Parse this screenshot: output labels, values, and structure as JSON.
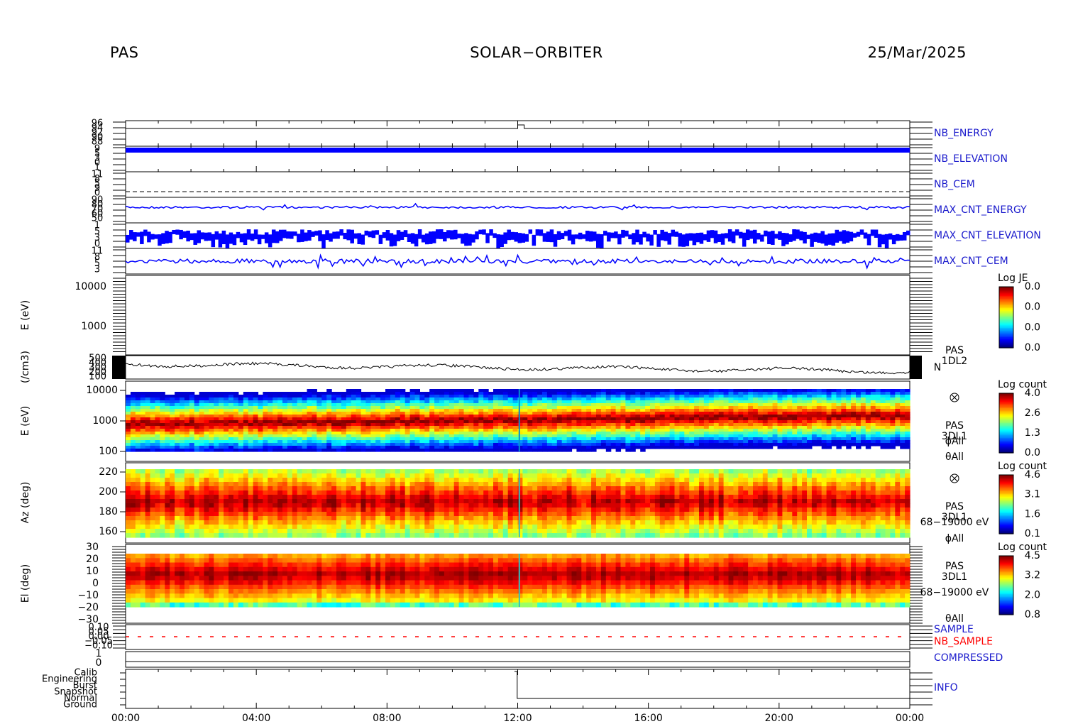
{
  "header": {
    "instrument": "PAS",
    "mission": "SOLAR−ORBITER",
    "date": "25/Mar/2025"
  },
  "colors": {
    "trace_blue": "#0000ff",
    "nb_sample_red": "#ff0000",
    "label_blue": "#1a1acc"
  },
  "chart_data": {
    "type": "heatmap",
    "time_axis": {
      "ticks": [
        "00:00",
        "04:00",
        "08:00",
        "12:00",
        "16:00",
        "20:00",
        "00:00"
      ],
      "range_hours": [
        0,
        24
      ]
    },
    "housekeeping_panels": [
      {
        "label": "NB_ENERGY",
        "y_ticks": [
          "96",
          "94",
          "92",
          "90",
          "88"
        ]
      },
      {
        "label": "NB_ELEVATION",
        "y_ticks": [
          "9",
          "5",
          "3",
          "0",
          "1"
        ]
      },
      {
        "label": "NB_CEM",
        "y_ticks": [
          "11",
          "8",
          "5",
          "9",
          "0"
        ]
      },
      {
        "label": "MAX_CNT_ENERGY",
        "y_ticks": [
          "90",
          "80",
          "70",
          "60",
          "50"
        ]
      },
      {
        "label": "MAX_CNT_ELEVATION",
        "y_ticks": [
          "1",
          "5",
          "3",
          "0"
        ]
      },
      {
        "label": "MAX_CNT_CEM",
        "y_ticks": [
          "11",
          "8",
          "5",
          "3"
        ]
      }
    ],
    "je_panel": {
      "ylabel": "E (eV)",
      "y_ticks": [
        "10000",
        "1000"
      ],
      "colorbar": {
        "title": "Log JE",
        "ticks": [
          "0.0",
          "0.0",
          "0.0",
          "0.0"
        ]
      }
    },
    "density_panel": {
      "ylabel": "(/cm3)",
      "y_ticks": [
        "500",
        "400",
        "300",
        "200",
        "100"
      ],
      "side_labels": [
        "PAS",
        "1DL2",
        "N"
      ],
      "median_density": 220
    },
    "energy_spectrogram": {
      "ylabel": "E (eV)",
      "y_ticks": [
        "10000",
        "1000",
        "100"
      ],
      "y_range_log": [
        2,
        4
      ],
      "side_labels": [
        "PAS",
        "3DL1",
        "ϕAll",
        "θAll"
      ],
      "colorbar": {
        "title": "Log count",
        "ticks": [
          "4.0",
          "2.6",
          "1.3",
          "0.0"
        ]
      }
    },
    "azimuth_spectrogram": {
      "ylabel": "Az (deg)",
      "y_ticks": [
        "220",
        "200",
        "180",
        "160"
      ],
      "y_range": [
        153,
        227
      ],
      "side_labels": [
        "PAS",
        "3DL1",
        "68−19000 eV",
        "ϕAll"
      ],
      "colorbar": {
        "title": "Log count",
        "ticks": [
          "4.6",
          "3.1",
          "1.6",
          "0.1"
        ]
      }
    },
    "elevation_spectrogram": {
      "ylabel": "El (deg)",
      "y_ticks": [
        "30",
        "20",
        "10",
        "0",
        "−10",
        "−20",
        "−30"
      ],
      "y_range": [
        -30,
        30
      ],
      "side_labels": [
        "PAS",
        "3DL1",
        "68−19000 eV",
        "θAll"
      ],
      "colorbar": {
        "title": "Log count",
        "ticks": [
          "4.5",
          "3.2",
          "2.0",
          "0.8"
        ]
      }
    },
    "sample_panel": {
      "labels": [
        "SAMPLE",
        "NB_SAMPLE"
      ],
      "y_ticks": [
        "0.10",
        "0.05",
        "0.00",
        "−0.05",
        "−0.10"
      ]
    },
    "compressed_panel": {
      "label": "COMPRESSED",
      "y_ticks": [
        "1",
        "0"
      ]
    },
    "info_panel": {
      "label": "INFO",
      "y_ticks": [
        "Calib",
        "Engineering",
        "Burst",
        "Snapshot",
        "Normal",
        "Ground"
      ],
      "mode_change_hour": 12.05
    }
  }
}
